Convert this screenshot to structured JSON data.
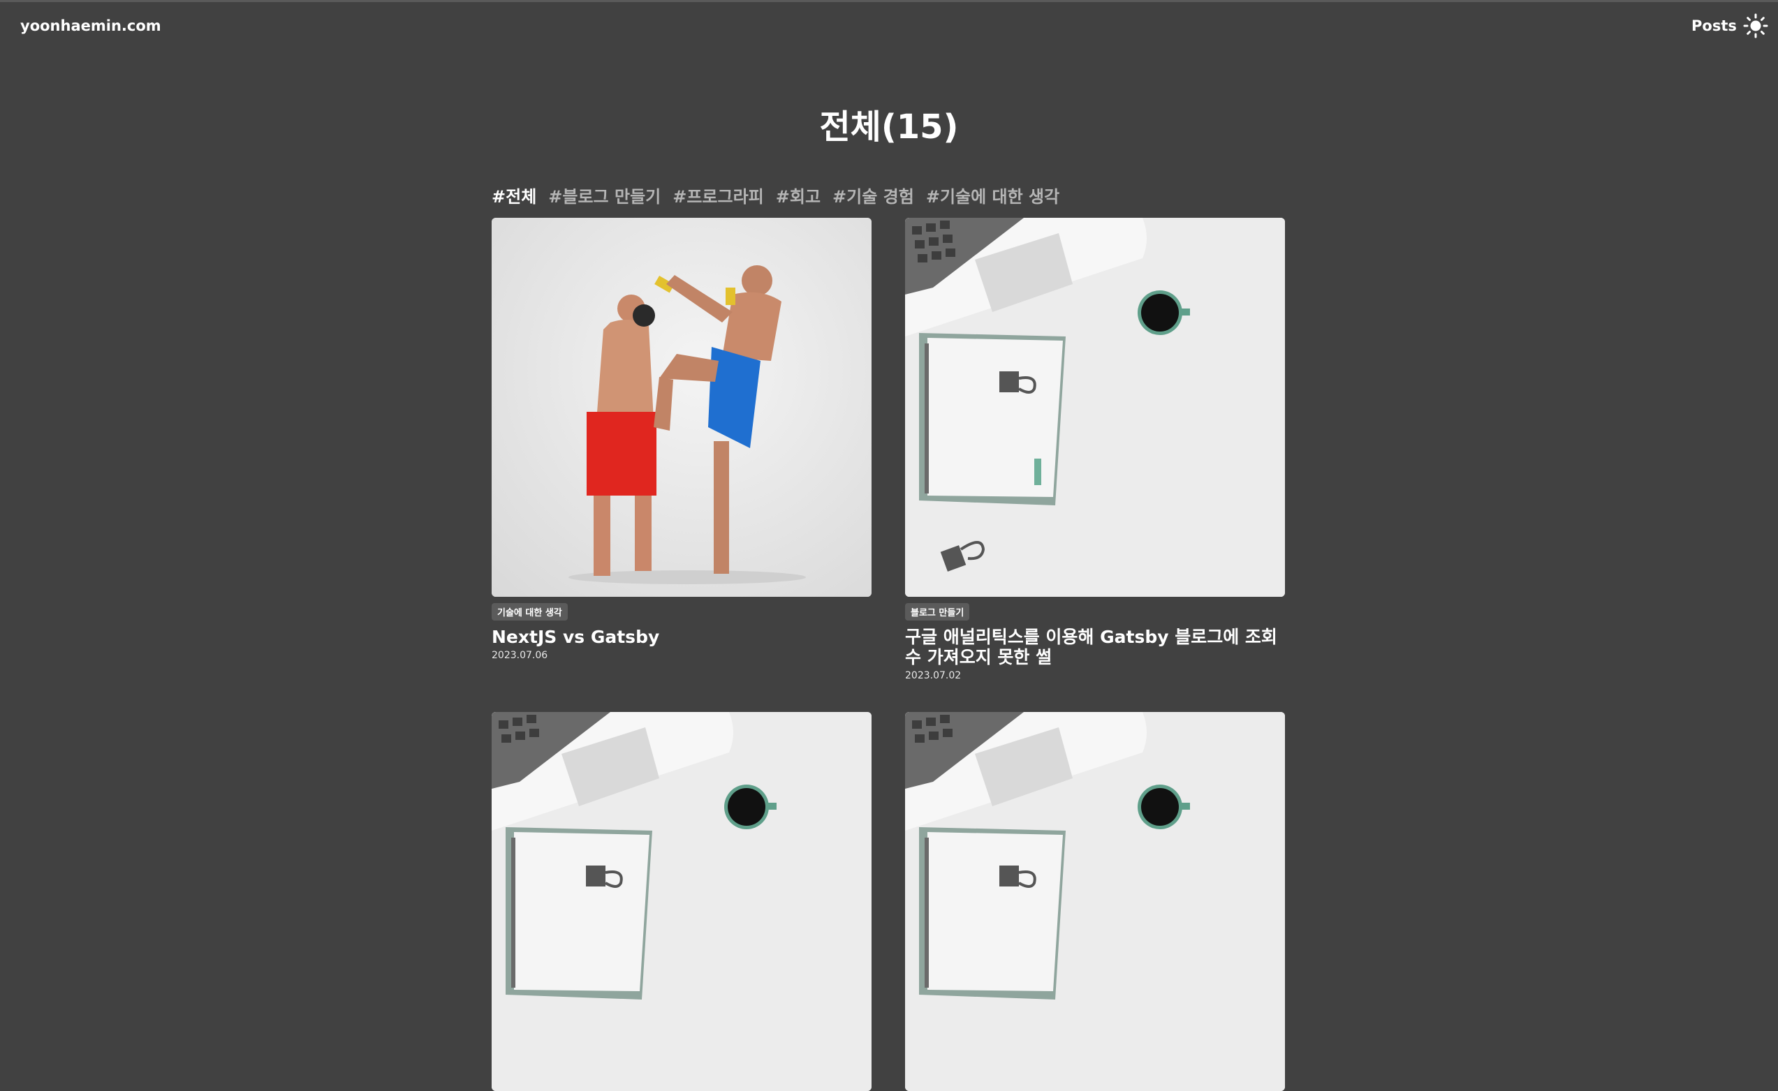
{
  "header": {
    "logo": "yoonhaemin.com",
    "nav_posts": "Posts",
    "theme_icon": "sun-icon"
  },
  "main": {
    "title": "전체(15)"
  },
  "tabs": [
    {
      "label": "#전체",
      "active": true
    },
    {
      "label": "#블로그 만들기",
      "active": false
    },
    {
      "label": "#프로그라피",
      "active": false
    },
    {
      "label": "#회고",
      "active": false
    },
    {
      "label": "#기술 경험",
      "active": false
    },
    {
      "label": "#기술에 대한 생각",
      "active": false
    }
  ],
  "posts": [
    {
      "category": "기술에 대한 생각",
      "title": "NextJS vs Gatsby",
      "date": "2023.07.06",
      "thumbnail": "kickboxing-photo"
    },
    {
      "category": "블로그 만들기",
      "title": "구글 애널리틱스를 이용해 Gatsby 블로그에 조회수 가져오지 못한 썰",
      "date": "2023.07.02",
      "thumbnail": "desk-notebook-coffee-photo"
    },
    {
      "thumbnail": "desk-notebook-coffee-photo"
    },
    {
      "thumbnail": "desk-notebook-coffee-photo"
    }
  ],
  "colors": {
    "background": "#414141",
    "text": "#ffffff",
    "inactive_tab": "#b5b5b5",
    "badge": "#5b5b5b"
  }
}
